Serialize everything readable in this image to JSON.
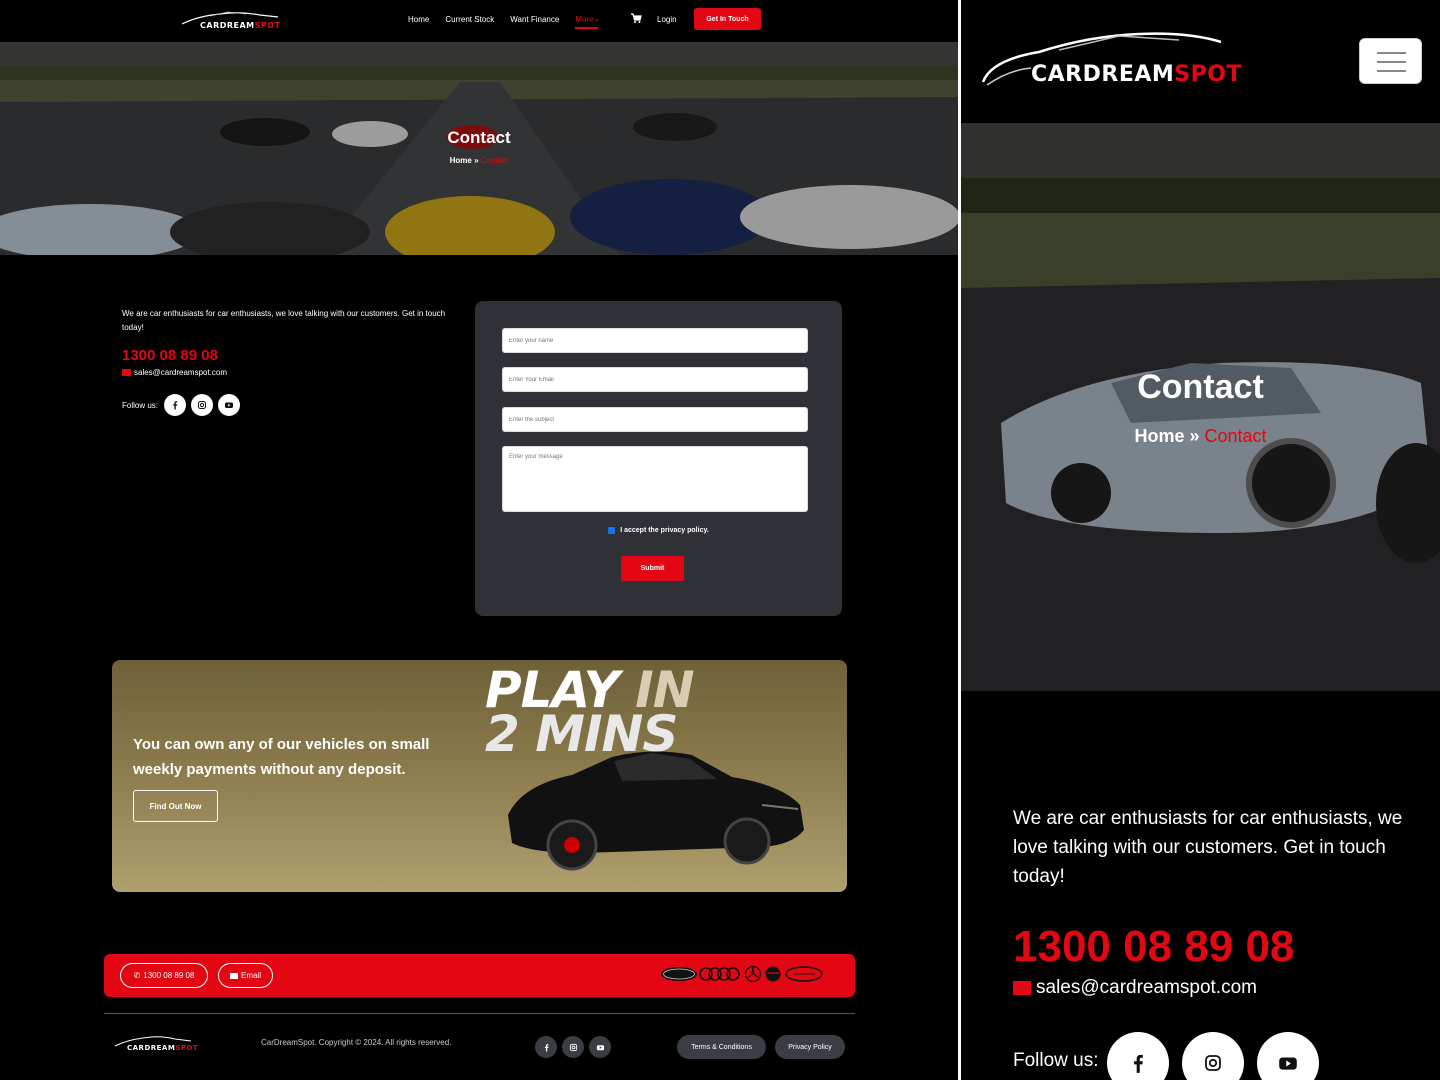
{
  "brand": {
    "part1": "CARDREAM",
    "part2": "SPOT",
    "accent_color": "#e30613"
  },
  "nav": {
    "items": [
      "Home",
      "Current Stock",
      "Want Finance",
      "More"
    ],
    "active": "More",
    "cart_icon": "cart-icon",
    "login": "Login",
    "cta": "Get In Touch"
  },
  "hero": {
    "title": "Contact",
    "crumb_home": "Home",
    "crumb_sep": " » ",
    "crumb_current": "Contact"
  },
  "contact": {
    "intro": "We are car enthusiasts for car enthusiasts, we love talking with our customers. Get in touch today!",
    "phone": "1300 08 89 08",
    "email": "sales@cardreamspot.com",
    "follow_label": "Follow us:",
    "socials": [
      "facebook-icon",
      "instagram-icon",
      "youtube-icon"
    ]
  },
  "form": {
    "name_placeholder": "Enter your name",
    "email_placeholder": "Enter Your Email",
    "subject_placeholder": "Enter the subject",
    "message_placeholder": "Enter your message",
    "consent": "I accept the privacy policy.",
    "consent_checked": true,
    "submit": "Submit"
  },
  "promo": {
    "headline_1a": "PLAY",
    "headline_1b": "IN",
    "headline_2": "2 MINS",
    "text": "You can own any of our vehicles on small weekly payments without any deposit.",
    "button": "Find Out Now"
  },
  "footer": {
    "call_pill": "1300 08 89 08",
    "email_pill": "Email",
    "brands": [
      "Ford",
      "Audi",
      "Mercedes-Benz",
      "Aston Martin",
      "Land Rover"
    ],
    "copyright": "CarDreamSpot. Copyright © 2024. All rights reserved.",
    "terms": "Terms & Conditions",
    "privacy": "Privacy Policy"
  }
}
